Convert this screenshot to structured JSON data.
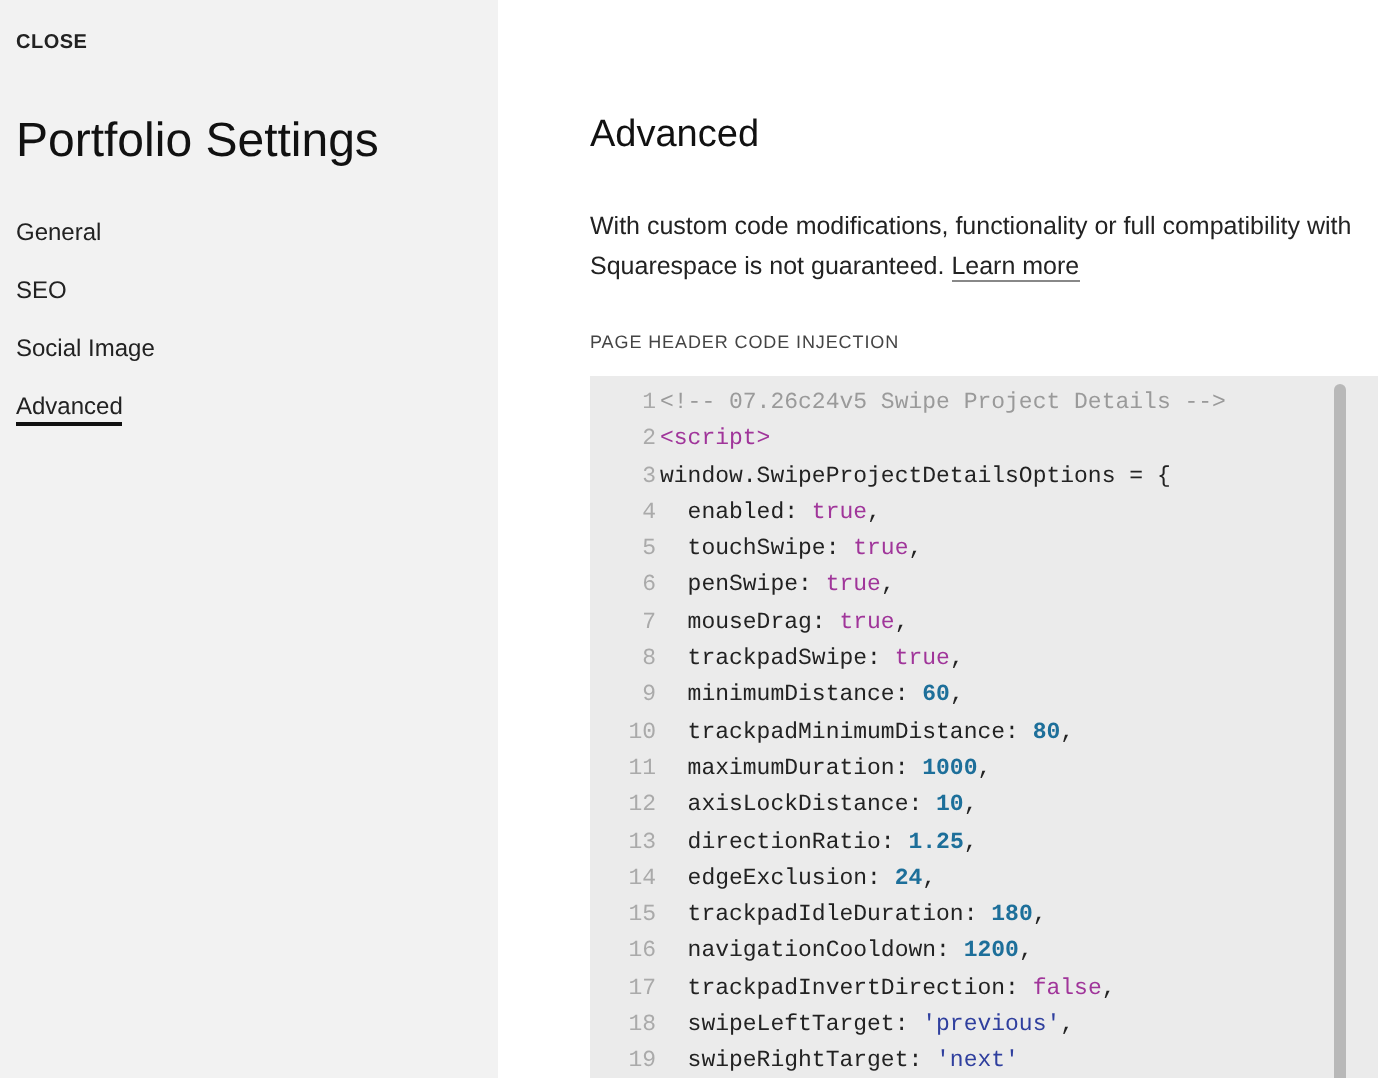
{
  "sidebar": {
    "close": "CLOSE",
    "title": "Portfolio Settings",
    "items": [
      {
        "label": "General",
        "selected": false
      },
      {
        "label": "SEO",
        "selected": false
      },
      {
        "label": "Social Image",
        "selected": false
      },
      {
        "label": "Advanced",
        "selected": true
      }
    ]
  },
  "main": {
    "title": "Advanced",
    "notice": "With custom code modifications, functionality or full compatibility with Squarespace is not guaranteed.",
    "link": "Learn more",
    "section_label": "PAGE HEADER CODE INJECTION",
    "code_lines": [
      {
        "number": "1",
        "tokens": [
          {
            "kind": "comment",
            "text": "<!-- 07.26c24v5 Swipe Project Details -->"
          }
        ]
      },
      {
        "number": "2",
        "tokens": [
          {
            "kind": "tag",
            "text": "<script>"
          }
        ]
      },
      {
        "number": "3",
        "tokens": [
          {
            "kind": "plain",
            "text": "window.SwipeProjectDetailsOptions = {"
          }
        ]
      },
      {
        "number": "4",
        "tokens": [
          {
            "kind": "plain",
            "text": "  enabled: "
          },
          {
            "kind": "keyword",
            "text": "true"
          },
          {
            "kind": "plain",
            "text": ","
          }
        ]
      },
      {
        "number": "5",
        "tokens": [
          {
            "kind": "plain",
            "text": "  touchSwipe: "
          },
          {
            "kind": "keyword",
            "text": "true"
          },
          {
            "kind": "plain",
            "text": ","
          }
        ]
      },
      {
        "number": "6",
        "tokens": [
          {
            "kind": "plain",
            "text": "  penSwipe: "
          },
          {
            "kind": "keyword",
            "text": "true"
          },
          {
            "kind": "plain",
            "text": ","
          }
        ]
      },
      {
        "number": "7",
        "tokens": [
          {
            "kind": "plain",
            "text": "  mouseDrag: "
          },
          {
            "kind": "keyword",
            "text": "true"
          },
          {
            "kind": "plain",
            "text": ","
          }
        ]
      },
      {
        "number": "8",
        "tokens": [
          {
            "kind": "plain",
            "text": "  trackpadSwipe: "
          },
          {
            "kind": "keyword",
            "text": "true"
          },
          {
            "kind": "plain",
            "text": ","
          }
        ]
      },
      {
        "number": "9",
        "tokens": [
          {
            "kind": "plain",
            "text": "  minimumDistance: "
          },
          {
            "kind": "number",
            "text": "60"
          },
          {
            "kind": "plain",
            "text": ","
          }
        ]
      },
      {
        "number": "10",
        "tokens": [
          {
            "kind": "plain",
            "text": "  trackpadMinimumDistance: "
          },
          {
            "kind": "number",
            "text": "80"
          },
          {
            "kind": "plain",
            "text": ","
          }
        ]
      },
      {
        "number": "11",
        "tokens": [
          {
            "kind": "plain",
            "text": "  maximumDuration: "
          },
          {
            "kind": "number",
            "text": "1000"
          },
          {
            "kind": "plain",
            "text": ","
          }
        ]
      },
      {
        "number": "12",
        "tokens": [
          {
            "kind": "plain",
            "text": "  axisLockDistance: "
          },
          {
            "kind": "number",
            "text": "10"
          },
          {
            "kind": "plain",
            "text": ","
          }
        ]
      },
      {
        "number": "13",
        "tokens": [
          {
            "kind": "plain",
            "text": "  directionRatio: "
          },
          {
            "kind": "number",
            "text": "1.25"
          },
          {
            "kind": "plain",
            "text": ","
          }
        ]
      },
      {
        "number": "14",
        "tokens": [
          {
            "kind": "plain",
            "text": "  edgeExclusion: "
          },
          {
            "kind": "number",
            "text": "24"
          },
          {
            "kind": "plain",
            "text": ","
          }
        ]
      },
      {
        "number": "15",
        "tokens": [
          {
            "kind": "plain",
            "text": "  trackpadIdleDuration: "
          },
          {
            "kind": "number",
            "text": "180"
          },
          {
            "kind": "plain",
            "text": ","
          }
        ]
      },
      {
        "number": "16",
        "tokens": [
          {
            "kind": "plain",
            "text": "  navigationCooldown: "
          },
          {
            "kind": "number",
            "text": "1200"
          },
          {
            "kind": "plain",
            "text": ","
          }
        ]
      },
      {
        "number": "17",
        "tokens": [
          {
            "kind": "plain",
            "text": "  trackpadInvertDirection: "
          },
          {
            "kind": "keyword",
            "text": "false"
          },
          {
            "kind": "plain",
            "text": ","
          }
        ]
      },
      {
        "number": "18",
        "tokens": [
          {
            "kind": "plain",
            "text": "  swipeLeftTarget: "
          },
          {
            "kind": "string",
            "text": "'previous'"
          },
          {
            "kind": "plain",
            "text": ","
          }
        ]
      },
      {
        "number": "19",
        "tokens": [
          {
            "kind": "plain",
            "text": "  swipeRightTarget: "
          },
          {
            "kind": "string",
            "text": "'next'"
          }
        ]
      }
    ]
  }
}
